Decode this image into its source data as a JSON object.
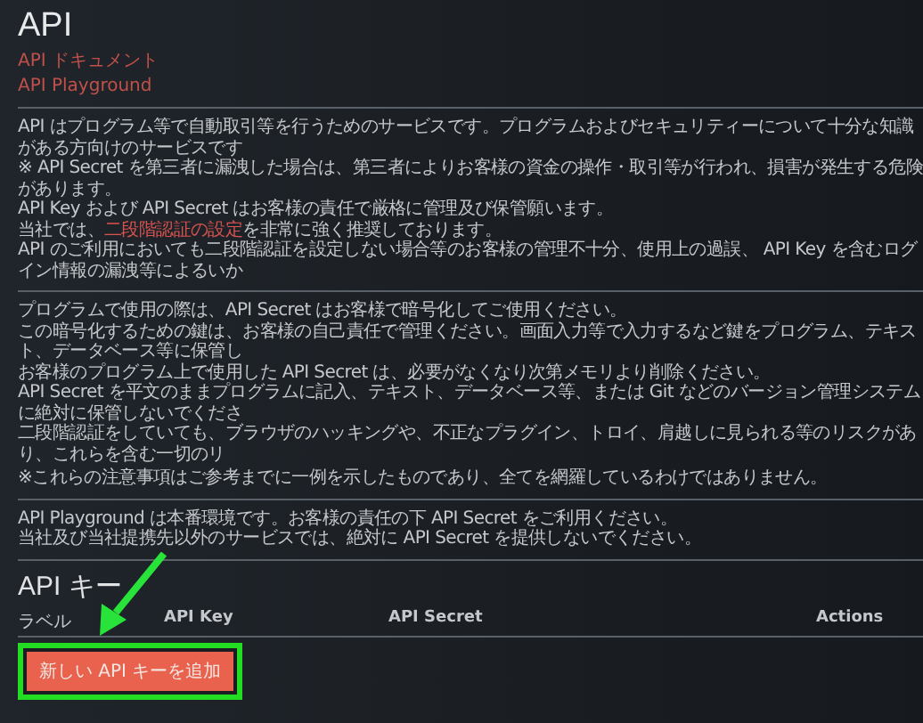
{
  "title": "API",
  "links": [
    "API ドキュメント",
    "API Playground"
  ],
  "sections": [
    {
      "lines": [
        [
          {
            "kind": "text",
            "text": "API はプログラム等で自動取引等を行うためのサービスです。プログラムおよびセキュリティーについて十分な知識がある方向けのサービスです"
          }
        ],
        [
          {
            "kind": "text",
            "text": "※ API Secret を第三者に漏洩した場合は、第三者によりお客様の資金の操作・取引等が行われ、損害が発生する危険があります。"
          }
        ],
        [
          {
            "kind": "text",
            "text": "API Key および API Secret はお客様の責任で厳格に管理及び保管願います。"
          }
        ],
        [
          {
            "kind": "text",
            "text": "当社では、"
          },
          {
            "kind": "link",
            "text": "二段階認証の設定"
          },
          {
            "kind": "text",
            "text": "を非常に強く推奨しております。"
          }
        ],
        [
          {
            "kind": "text",
            "text": "API のご利用においても二段階認証を設定しない場合等のお客様の管理不十分、使用上の過誤、 API Key を含むログイン情報の漏洩等によるいか"
          }
        ]
      ]
    },
    {
      "lines": [
        [
          {
            "kind": "text",
            "text": "プログラムで使用の際は、API Secret はお客様で暗号化してご使用ください。"
          }
        ],
        [
          {
            "kind": "text",
            "text": "この暗号化するための鍵は、お客様の自己責任で管理ください。画面入力等で入力するなど鍵をプログラム、テキスト、データベース等に保管し"
          }
        ],
        [
          {
            "kind": "text",
            "text": "お客様のプログラム上で使用した API Secret は、必要がなくなり次第メモリより削除ください。"
          }
        ],
        [
          {
            "kind": "text",
            "text": "API Secret を平文のままプログラムに記入、テキスト、データベース等、または Git などのバージョン管理システムに絶対に保管しないでくださ"
          }
        ],
        [
          {
            "kind": "text",
            "text": "二段階認証をしていても、ブラウザのハッキングや、不正なプラグイン、トロイ、肩越しに見られる等のリスクがあり、これらを含む一切のリ"
          }
        ],
        [
          {
            "kind": "note",
            "text": "※これらの注意事項はご参考までに一例を示したものであり、全てを網羅しているわけではありません。"
          }
        ]
      ]
    },
    {
      "lines": [
        [
          {
            "kind": "text",
            "text": "API Playground は本番環境です。お客様の責任の下 API Secret をご利用ください。"
          }
        ],
        [
          {
            "kind": "text",
            "text": "当社及び当社提携先以外のサービスでは、絶対に API Secret を提供しないでください。"
          }
        ]
      ]
    }
  ],
  "keys": {
    "heading": "API キー",
    "columns": [
      "ラベル",
      "API Key",
      "API Secret",
      "Actions"
    ],
    "add_button": "新しい API キーを追加"
  }
}
